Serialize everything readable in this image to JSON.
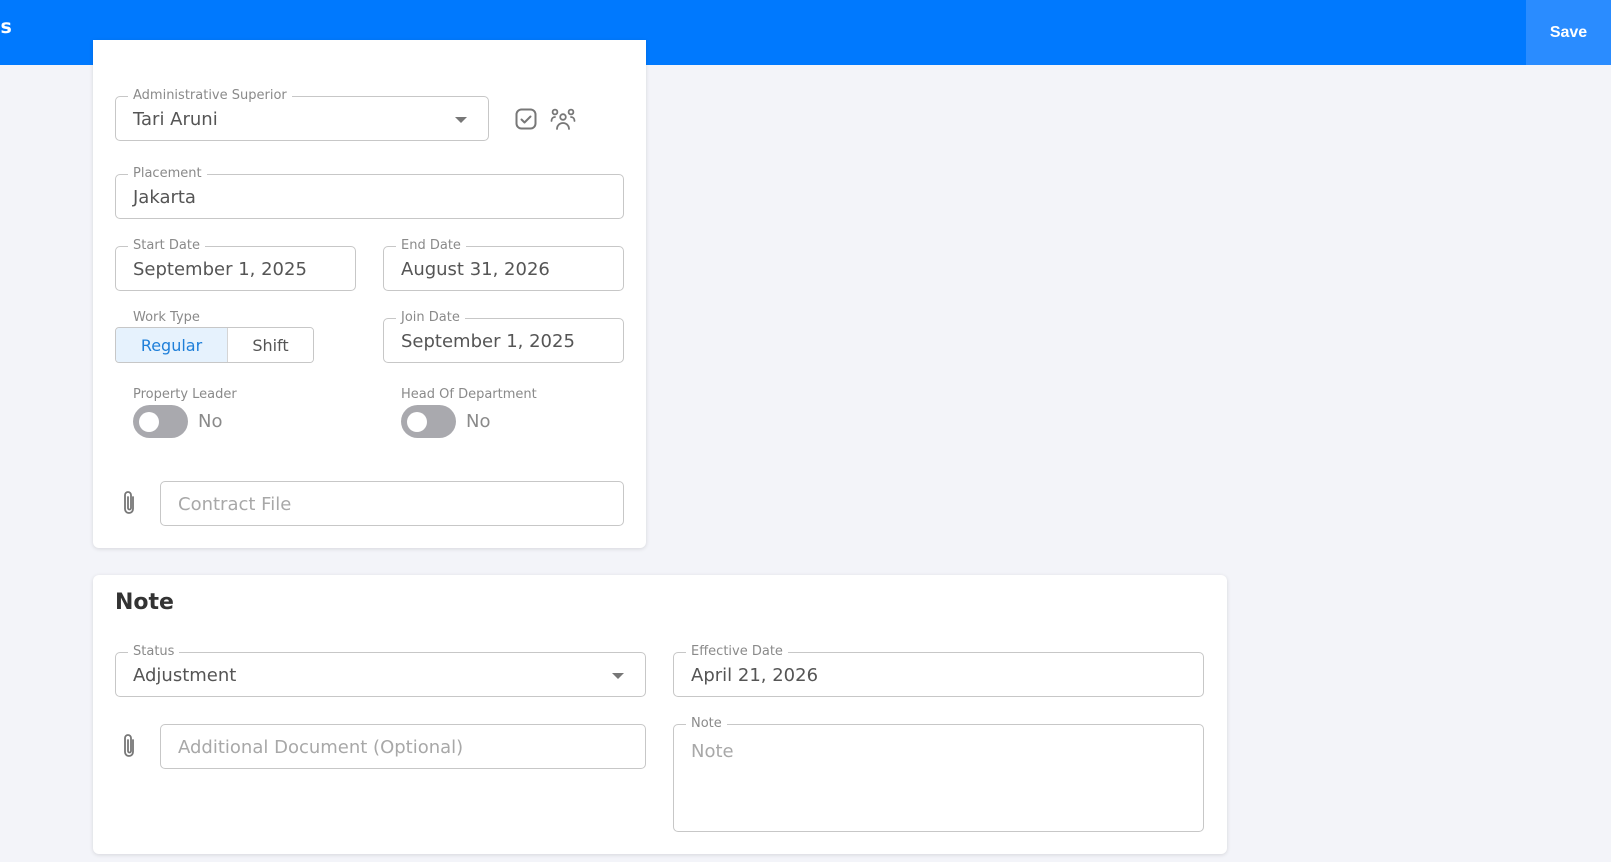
{
  "header": {
    "title_fragment": "ls",
    "save_label": "Save"
  },
  "employment": {
    "administrative_superior": {
      "label": "Administrative Superior",
      "value": "Tari Aruni"
    },
    "placement": {
      "label": "Placement",
      "value": "Jakarta"
    },
    "start_date": {
      "label": "Start Date",
      "value": "September 1, 2025"
    },
    "end_date": {
      "label": "End Date",
      "value": "August 31, 2026"
    },
    "work_type": {
      "label": "Work Type",
      "options": [
        "Regular",
        "Shift"
      ],
      "selected": "Regular"
    },
    "join_date": {
      "label": "Join Date",
      "value": "September 1, 2025"
    },
    "property_leader": {
      "label": "Property Leader",
      "value": "No"
    },
    "head_of_department": {
      "label": "Head Of Department",
      "value": "No"
    },
    "contract_file": {
      "placeholder": "Contract File"
    }
  },
  "note_section": {
    "title": "Note",
    "status": {
      "label": "Status",
      "value": "Adjustment"
    },
    "effective_date": {
      "label": "Effective Date",
      "value": "April 21, 2026"
    },
    "additional_document": {
      "placeholder": "Additional Document (Optional)"
    },
    "note": {
      "label": "Note",
      "placeholder": "Note"
    }
  },
  "colors": {
    "primary": "#0079fe",
    "background": "#f3f4f9",
    "segment_active_bg": "#e6f2fd",
    "segment_active_text": "#1e7fd9",
    "toggle_off": "#a9a9ae"
  },
  "icons": [
    "check-square-icon",
    "team-icon",
    "paperclip-icon",
    "chevron-down-icon"
  ]
}
